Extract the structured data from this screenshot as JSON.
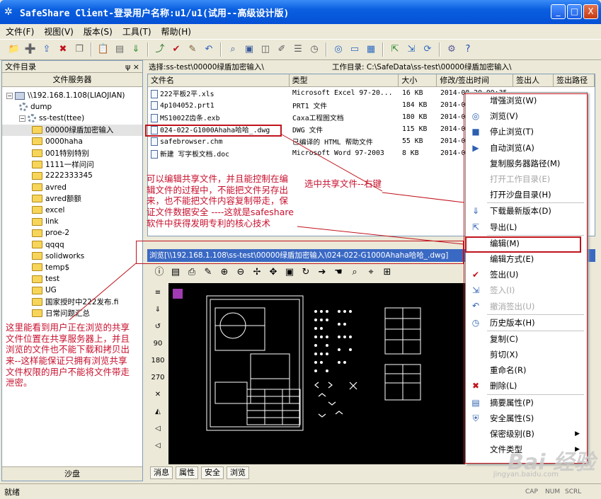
{
  "window": {
    "title": "SafeShare Client-登录用户名称:u1/u1(试用--高级设计版)",
    "buttons": [
      "_",
      "□",
      "X"
    ]
  },
  "menu": [
    "文件(F)",
    "视图(V)",
    "版本(S)",
    "工具(T)",
    "帮助(H)"
  ],
  "toolbar_icons": [
    "new-folder-icon",
    "add-icon",
    "upload-icon",
    "delete-icon",
    "copy-icon",
    "paste-icon",
    "paste2-icon",
    "download-icon",
    "checkout-icon",
    "checkin-icon",
    "edit-icon",
    "undo-icon",
    "search-icon",
    "view-icon",
    "preview-icon",
    "rename-icon",
    "list-icon",
    "history-icon",
    "browse-icon",
    "monitor-icon",
    "tile-icon",
    "export-icon",
    "import-icon",
    "refresh-icon",
    "settings-icon",
    "help-icon"
  ],
  "left_panel": {
    "header": "文件目录",
    "pin": "ψ ×",
    "tab": "文件服务器",
    "bottom": "沙盘",
    "tree": [
      {
        "label": "\\\\192.168.1.108(LIAOJIAN)",
        "level": 0,
        "kind": "pc"
      },
      {
        "label": "dump",
        "level": 1,
        "kind": "gear"
      },
      {
        "label": "ss-test(ttee)",
        "level": 1,
        "kind": "gear"
      },
      {
        "label": "00000绿盾加密输入",
        "level": 2,
        "kind": "folder",
        "selected": true
      },
      {
        "label": "0000haha",
        "level": 2,
        "kind": "folder"
      },
      {
        "label": "001特别特别",
        "level": 2,
        "kind": "folder"
      },
      {
        "label": "1111一样问问",
        "level": 2,
        "kind": "folder"
      },
      {
        "label": "2222333345",
        "level": 2,
        "kind": "folder"
      },
      {
        "label": "avred",
        "level": 2,
        "kind": "folder"
      },
      {
        "label": "avred额额",
        "level": 2,
        "kind": "folder"
      },
      {
        "label": "excel",
        "level": 2,
        "kind": "folder"
      },
      {
        "label": "link",
        "level": 2,
        "kind": "folder"
      },
      {
        "label": "proe-2",
        "level": 2,
        "kind": "folder"
      },
      {
        "label": "qqqq",
        "level": 2,
        "kind": "folder"
      },
      {
        "label": "solidworks",
        "level": 2,
        "kind": "folder"
      },
      {
        "label": "temp$",
        "level": 2,
        "kind": "folder"
      },
      {
        "label": "test",
        "level": 2,
        "kind": "folder"
      },
      {
        "label": "UG",
        "level": 2,
        "kind": "folder"
      },
      {
        "label": "国家授时中222发布.fi",
        "level": 2,
        "kind": "folder"
      },
      {
        "label": "日常问题汇总",
        "level": 2,
        "kind": "folder"
      }
    ]
  },
  "pathbar": {
    "selection": "选择:ss-test\\00000绿盾加密输入\\",
    "workdir": "工作目录: C:\\SafeData\\ss-test\\00000绿盾加密输入\\"
  },
  "filelist": {
    "columns": [
      "文件名",
      "类型",
      "大小",
      "修改/签出时间",
      "签出人",
      "签出路径"
    ],
    "rows": [
      [
        "222平板2平.xls",
        "Microsoft Excel 97-20...",
        "16 KB",
        "2014-08-20 09:35"
      ],
      [
        "4p104052.prt1",
        "PRT1 文件",
        "184 KB",
        "2014-0"
      ],
      [
        "MS1002Z齿条.exb",
        "Caxa工程图文档",
        "180 KB",
        "2014-0"
      ],
      [
        "024-022-G1000Ahaha哈哈_.dwg",
        "DWG 文件",
        "115 KB",
        "2014-0"
      ],
      [
        "safebrowser.chm",
        "已编译的 HTML 帮助文件",
        "55 KB",
        "2014-0"
      ],
      [
        "新建 写字板文档.doc",
        "Microsoft Word 97-2003",
        "8 KB",
        "2014-0"
      ]
    ]
  },
  "browse_path": "浏览[\\\\192.168.1.108\\ss-test\\00000绿盾加密输入\\024-022-G1000Ahaha哈哈_.dwg]",
  "view_tools": [
    "info-icon",
    "save-icon",
    "print-icon",
    "pen-icon",
    "zoom-in-icon",
    "zoom-out-icon",
    "fit-icon",
    "pan-icon",
    "layer-icon",
    "rotate-icon",
    "arrow-icon",
    "hand-icon",
    "zoom-window-icon",
    "zoom-all-icon",
    "measure-icon"
  ],
  "left_tools": [
    "≡",
    "⇓",
    "↺",
    "90",
    "180",
    "270",
    "✕",
    "◭",
    "◁",
    "◁"
  ],
  "bottom_tabs": [
    "消息",
    "属性",
    "安全",
    "浏览"
  ],
  "status": {
    "text": "就绪",
    "caps": "CAP",
    "num": "NUM",
    "scrl": "SCRL"
  },
  "context_menu": [
    {
      "label": "增强浏览(W)",
      "icon": "",
      "disabled": false
    },
    {
      "label": "浏览(V)",
      "icon": "browse-icon",
      "disabled": false
    },
    {
      "label": "停止浏览(T)",
      "icon": "stop-icon",
      "disabled": false
    },
    {
      "label": "自动浏览(A)",
      "icon": "auto-icon",
      "disabled": false
    },
    {
      "label": "复制服务器路径(M)",
      "icon": "",
      "disabled": false
    },
    {
      "label": "打开工作目录(E)",
      "icon": "",
      "disabled": true
    },
    {
      "label": "打开沙盘目录(H)",
      "icon": "",
      "disabled": false,
      "sep": true
    },
    {
      "label": "下载最新版本(D)",
      "icon": "download-icon",
      "disabled": false
    },
    {
      "label": "导出(L)",
      "icon": "export-icon",
      "disabled": false,
      "sep": true
    },
    {
      "label": "编辑(M)",
      "icon": "",
      "disabled": false,
      "highlight": true
    },
    {
      "label": "编辑方式(E)",
      "icon": "",
      "disabled": false
    },
    {
      "label": "签出(U)",
      "icon": "check-icon",
      "disabled": false
    },
    {
      "label": "签入(I)",
      "icon": "checkin-icon",
      "disabled": true
    },
    {
      "label": "撤消签出(U)",
      "icon": "undo-icon",
      "disabled": true,
      "sep": true
    },
    {
      "label": "历史版本(H)",
      "icon": "history-icon",
      "disabled": false,
      "sep": true
    },
    {
      "label": "复制(C)",
      "icon": "",
      "disabled": false
    },
    {
      "label": "剪切(X)",
      "icon": "",
      "disabled": false
    },
    {
      "label": "重命名(R)",
      "icon": "",
      "disabled": false
    },
    {
      "label": "删除(L)",
      "icon": "delete-icon",
      "disabled": false,
      "sep": true
    },
    {
      "label": "摘要属性(P)",
      "icon": "props-icon",
      "disabled": false
    },
    {
      "label": "安全属性(S)",
      "icon": "security-icon",
      "disabled": false
    },
    {
      "label": "保密级别(B)",
      "icon": "",
      "disabled": false,
      "submenu": true
    },
    {
      "label": "文件类型",
      "icon": "",
      "disabled": false,
      "submenu": true
    }
  ],
  "annotations": {
    "edit_note": "可以编辑共享文件，并且能控制在编辑文件的过程中，不能把文件另存出来，也不能把文件内容复制带走，保证文件数据安全 ----这就是safeshare软件中获得发明专利的核心技术",
    "select_note": "选中共享文件--右键",
    "browse_note": "这里能看到用户正在浏览的共享文件位置在共享服务器上，并且浏览的文件也不能下载和拷贝出来--这样能保证只拥有浏览共享文件权限的用户不能将文件带走泄密。"
  },
  "watermark": {
    "main": "Bai 经验",
    "sub": "jingyan.baidu.com"
  },
  "colors": {
    "annotation_red": "#c8102e",
    "titlebar_blue": "#0551d6",
    "browse_bar": "#3a69c4"
  }
}
